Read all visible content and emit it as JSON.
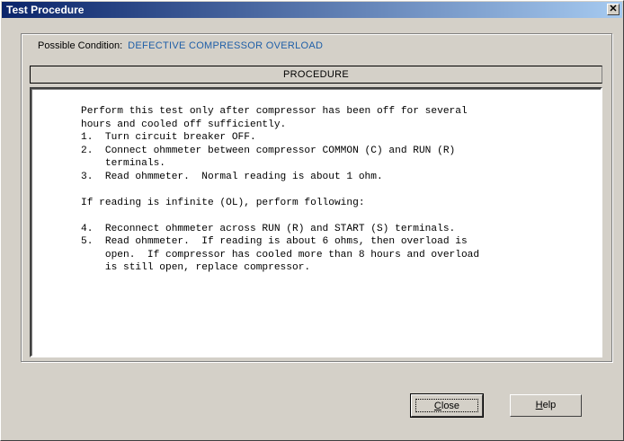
{
  "window": {
    "title": "Test Procedure",
    "close_glyph": "✕"
  },
  "condition": {
    "label": "Possible Condition:",
    "value": "DEFECTIVE COMPRESSOR OVERLOAD"
  },
  "procedure": {
    "header": "PROCEDURE",
    "text": "Perform this test only after compressor has been off for several\nhours and cooled off sufficiently.\n1.  Turn circuit breaker OFF.\n2.  Connect ohmmeter between compressor COMMON (C) and RUN (R)\n    terminals.\n3.  Read ohmmeter.  Normal reading is about 1 ohm.\n\nIf reading is infinite (OL), perform following:\n\n4.  Reconnect ohmmeter across RUN (R) and START (S) terminals.\n5.  Read ohmmeter.  If reading is about 6 ohms, then overload is\n    open.  If compressor has cooled more than 8 hours and overload\n    is still open, replace compressor."
  },
  "buttons": {
    "close_hotkey": "C",
    "close_rest": "lose",
    "help_hotkey": "H",
    "help_rest": "elp"
  }
}
